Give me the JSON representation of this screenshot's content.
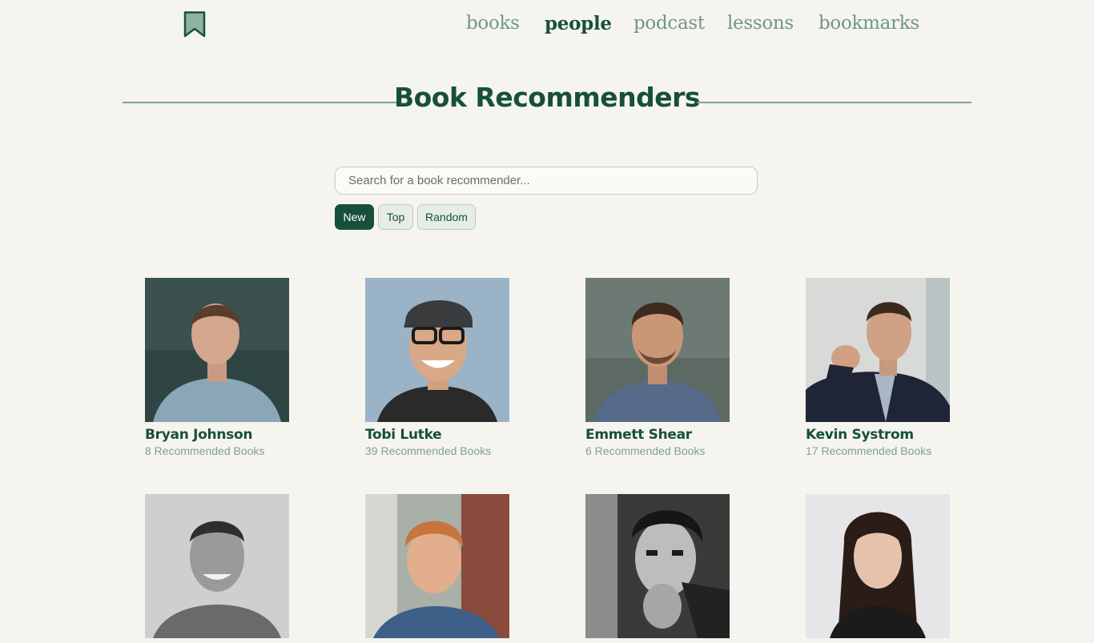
{
  "nav": {
    "items": [
      {
        "label": "books",
        "active": false
      },
      {
        "label": "people",
        "active": true
      },
      {
        "label": "podcast",
        "active": false
      },
      {
        "label": "lessons",
        "active": false
      },
      {
        "label": "bookmarks",
        "active": false
      }
    ]
  },
  "page": {
    "title": "Book Recommenders"
  },
  "search": {
    "placeholder": "Search for a book recommender..."
  },
  "filters": [
    {
      "label": "New",
      "active": true
    },
    {
      "label": "Top",
      "active": false
    },
    {
      "label": "Random",
      "active": false
    }
  ],
  "people": [
    {
      "name": "Bryan Johnson",
      "count": "8 Recommended Books"
    },
    {
      "name": "Tobi Lutke",
      "count": "39 Recommended Books"
    },
    {
      "name": "Emmett Shear",
      "count": "6 Recommended Books"
    },
    {
      "name": "Kevin Systrom",
      "count": "17 Recommended Books"
    },
    {
      "name": "",
      "count": ""
    },
    {
      "name": "",
      "count": ""
    },
    {
      "name": "",
      "count": ""
    },
    {
      "name": "",
      "count": ""
    }
  ],
  "colors": {
    "brand": "#17503a",
    "accent_muted": "#6f9884",
    "background": "#f6f4ef"
  },
  "icons": {
    "logo": "bookmark-icon"
  }
}
